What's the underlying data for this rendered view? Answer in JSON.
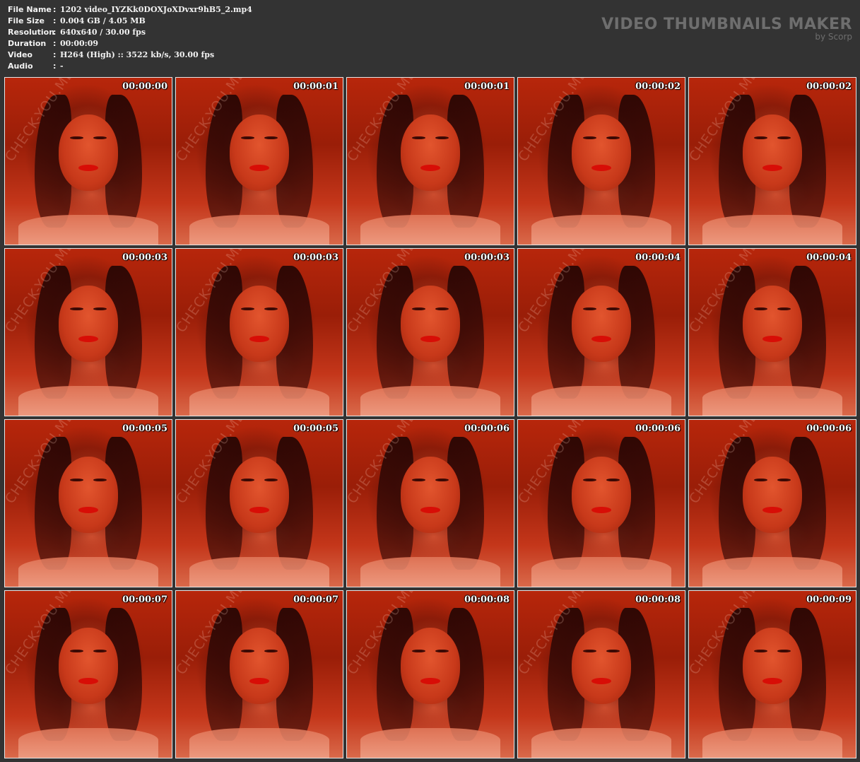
{
  "info": {
    "rows": [
      {
        "label": "File Name",
        "colon": ":",
        "value": "1202 video_IYZKk0DOXJoXDvxr9hB5_2.mp4"
      },
      {
        "label": "File Size",
        "colon": ":",
        "value": "0.004 GB  / 4.05 MB"
      },
      {
        "label": "Resolution",
        "colon": ":",
        "value": "640x640 / 30.00 fps"
      },
      {
        "label": "Duration",
        "colon": ":",
        "value": "00:00:09"
      },
      {
        "label": "Video",
        "colon": ":",
        "value": "H264 (High) :: 3522 kb/s, 30.00 fps"
      },
      {
        "label": "Audio",
        "colon": ":",
        "value": "-"
      }
    ]
  },
  "brand": {
    "title": "VIDEO THUMBNAILS MAKER",
    "subtitle": "by Scorp"
  },
  "thumbnails": [
    {
      "timestamp": "00:00:00",
      "watermark": "CHECK-YOU.ME"
    },
    {
      "timestamp": "00:00:01",
      "watermark": "CHECK-YOU.ME"
    },
    {
      "timestamp": "00:00:01",
      "watermark": "CHECK-YOU.ME"
    },
    {
      "timestamp": "00:00:02",
      "watermark": "CHECK-YOU.ME"
    },
    {
      "timestamp": "00:00:02",
      "watermark": "CHECK-YOU.ME"
    },
    {
      "timestamp": "00:00:03",
      "watermark": "CHECK-YOU.ME"
    },
    {
      "timestamp": "00:00:03",
      "watermark": "CHECK-YOU.ME"
    },
    {
      "timestamp": "00:00:03",
      "watermark": "CHECK-YOU.ME"
    },
    {
      "timestamp": "00:00:04",
      "watermark": "CHECK-YOU.ME"
    },
    {
      "timestamp": "00:00:04",
      "watermark": "CHECK-YOU.ME"
    },
    {
      "timestamp": "00:00:05",
      "watermark": "CHECK-YOU.ME"
    },
    {
      "timestamp": "00:00:05",
      "watermark": "CHECK-YOU.ME"
    },
    {
      "timestamp": "00:00:06",
      "watermark": "CHECK-YOU.ME"
    },
    {
      "timestamp": "00:00:06",
      "watermark": "CHECK-YOU.ME"
    },
    {
      "timestamp": "00:00:06",
      "watermark": "CHECK-YOU.ME"
    },
    {
      "timestamp": "00:00:07",
      "watermark": "CHECK-YOU.ME"
    },
    {
      "timestamp": "00:00:07",
      "watermark": "CHECK-YOU.ME"
    },
    {
      "timestamp": "00:00:08",
      "watermark": "CHECK-YOU.ME"
    },
    {
      "timestamp": "00:00:08",
      "watermark": "CHECK-YOU.ME"
    },
    {
      "timestamp": "00:00:09",
      "watermark": "CHECK-YOU.ME"
    }
  ],
  "colors": {
    "background": "#333333",
    "brand": "#6e6e6e",
    "thumb_border": "#e6e6e6"
  }
}
